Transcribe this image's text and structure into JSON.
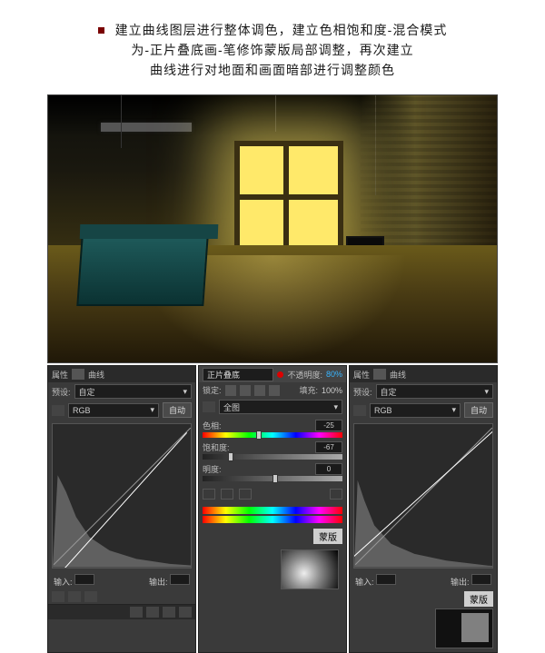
{
  "header": {
    "line1": "建立曲线图层进行整体调色，建立色相饱和度-混合模式",
    "line2": "为-正片叠底画-笔修饰蒙版局部调整，再次建立",
    "line3": "曲线进行对地面和画面暗部进行调整颜色"
  },
  "leftPanel": {
    "title_prefix": "属性",
    "title": "曲线",
    "preset_label": "预设:",
    "preset_value": "自定",
    "channel_value": "RGB",
    "auto_btn": "自动",
    "input_label": "输入:",
    "output_label": "输出:"
  },
  "centerPanel": {
    "blend_mode": "正片叠底",
    "opacity_label": "不透明度:",
    "opacity_value": "80%",
    "lock_label": "锁定:",
    "fill_label": "填充:",
    "fill_value": "100%",
    "master_label": "全图",
    "hue_label": "色相:",
    "hue_value": "-25",
    "sat_label": "饱和度:",
    "sat_value": "-67",
    "light_label": "明度:",
    "light_value": "0",
    "mask_label": "蒙版"
  },
  "rightPanel": {
    "title_prefix": "属性",
    "title": "曲线",
    "preset_label": "预设:",
    "preset_value": "自定",
    "channel_value": "RGB",
    "auto_btn": "自动",
    "input_label": "输入:",
    "output_label": "输出:",
    "mask_label": "蒙版"
  }
}
